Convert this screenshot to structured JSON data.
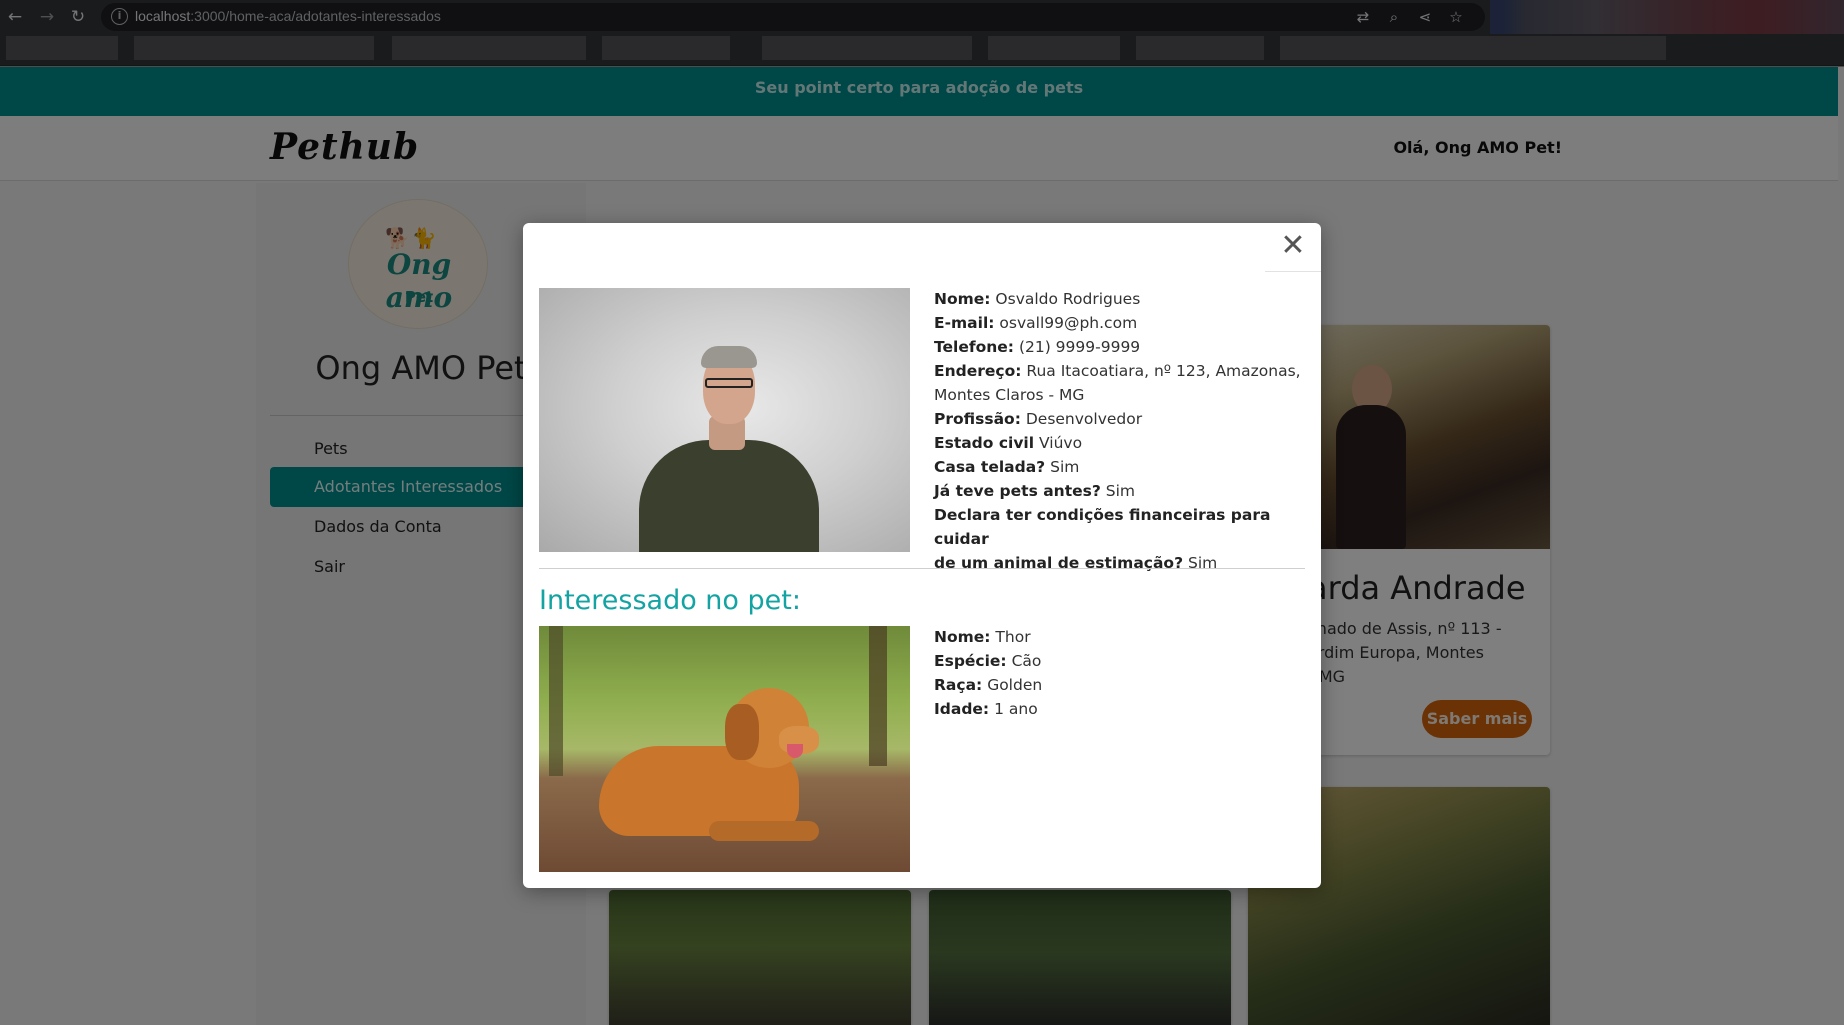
{
  "browser": {
    "url_host": "localhost",
    "url_path": ":3000/home-aca/adotantes-interessados"
  },
  "site": {
    "banner": "Seu point certo para adoção de pets",
    "logo": "Pethub",
    "greeting": "Olá, Ong AMO Pet!"
  },
  "sidebar": {
    "avatar_line1": "Ong",
    "avatar_line2": "amo",
    "avatar_line3": "Pet",
    "org_name": "Ong AMO Pet",
    "items": [
      {
        "label": "Pets"
      },
      {
        "label": "Adotantes Interessados",
        "active": true
      },
      {
        "label": "Dados da Conta"
      },
      {
        "label": "Sair"
      }
    ]
  },
  "background_cards": {
    "card1_title": "arda Andrade",
    "card1_address_line1": "chado de Assis, nº 113 -",
    "card1_address_line2": "ardim Europa, Montes",
    "card1_address_line3": "- MG",
    "card1_button": "Saber mais"
  },
  "modal": {
    "close_glyph": "✕",
    "adopter": {
      "name_label": "Nome:",
      "name": "Osvaldo Rodrigues",
      "email_label": "E-mail:",
      "email": "osvall99@ph.com",
      "phone_label": "Telefone:",
      "phone": "(21) 9999-9999",
      "address_label": "Endereço:",
      "address_line1": "Rua Itacoatiara, nº 123, Amazonas,",
      "address_line2": "Montes Claros - MG",
      "profession_label": "Profissão:",
      "profession": "Desenvolvedor",
      "civil_label": "Estado civil",
      "civil": "Viúvo",
      "screened_label": "Casa telada?",
      "screened": "Sim",
      "had_pets_label": "Já teve pets antes?",
      "had_pets": "Sim",
      "finance_label_line1": "Declara ter condições financeiras para cuidar",
      "finance_label_line2": "de um animal de estimação?",
      "finance": "Sim"
    },
    "pet_heading": "Interessado no pet:",
    "pet": {
      "name_label": "Nome:",
      "name": "Thor",
      "species_label": "Espécie:",
      "species": "Cão",
      "breed_label": "Raça:",
      "breed": "Golden",
      "age_label": "Idade:",
      "age": "1 ano"
    }
  }
}
